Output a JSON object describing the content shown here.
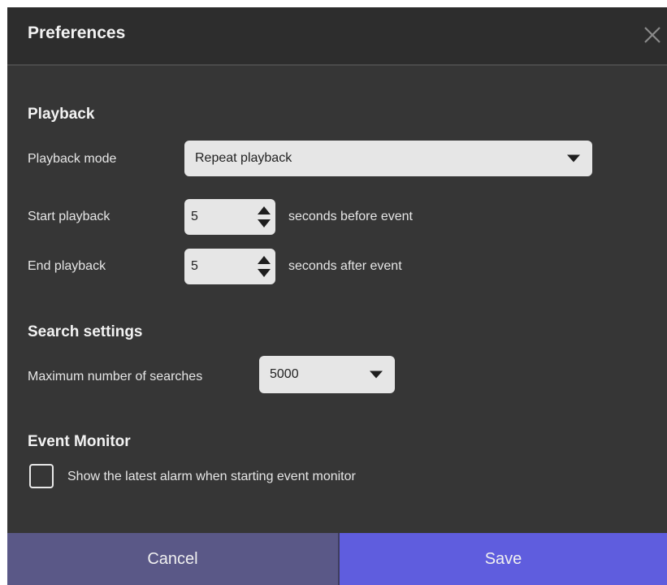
{
  "dialog": {
    "title": "Preferences",
    "close_icon": "close-icon"
  },
  "playback": {
    "heading": "Playback",
    "mode_label": "Playback mode",
    "mode_value": "Repeat playback",
    "start_label": "Start playback",
    "start_value": "5",
    "start_suffix": "seconds before event",
    "end_label": "End playback",
    "end_value": "5",
    "end_suffix": "seconds after event"
  },
  "search": {
    "heading": "Search settings",
    "max_label": "Maximum number of searches",
    "max_value": "5000"
  },
  "event_monitor": {
    "heading": "Event Monitor",
    "checkbox_label": "Show the latest alarm when starting event monitor",
    "checked": false
  },
  "footer": {
    "cancel_label": "Cancel",
    "save_label": "Save"
  },
  "colors": {
    "background": "#363636",
    "header": "#2d2d2d",
    "cancel": "#5a5887",
    "save": "#5f5dde"
  }
}
